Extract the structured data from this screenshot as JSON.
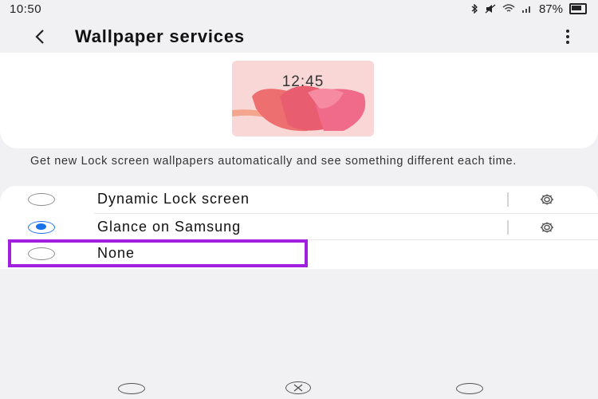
{
  "status_bar": {
    "time": "10:50",
    "battery": "87%",
    "icons": [
      "bluetooth-icon",
      "mute-icon",
      "wifi-icon",
      "signal-icon",
      "battery-icon"
    ]
  },
  "header": {
    "title": "Wallpaper services",
    "back_icon": "chevron-left-icon",
    "more_icon": "more-vertical-icon"
  },
  "preview": {
    "time": "12:45"
  },
  "description": "Get new Lock screen wallpapers automatically and see something different each time.",
  "options": [
    {
      "label": "Dynamic Lock screen",
      "selected": false,
      "has_settings": true
    },
    {
      "label": "Glance on Samsung",
      "selected": true,
      "has_settings": true
    },
    {
      "label": "None",
      "selected": false,
      "has_settings": false
    }
  ],
  "colors": {
    "accent": "#1a73e8",
    "highlight": "#a11fde",
    "background": "#f1f1f3"
  }
}
